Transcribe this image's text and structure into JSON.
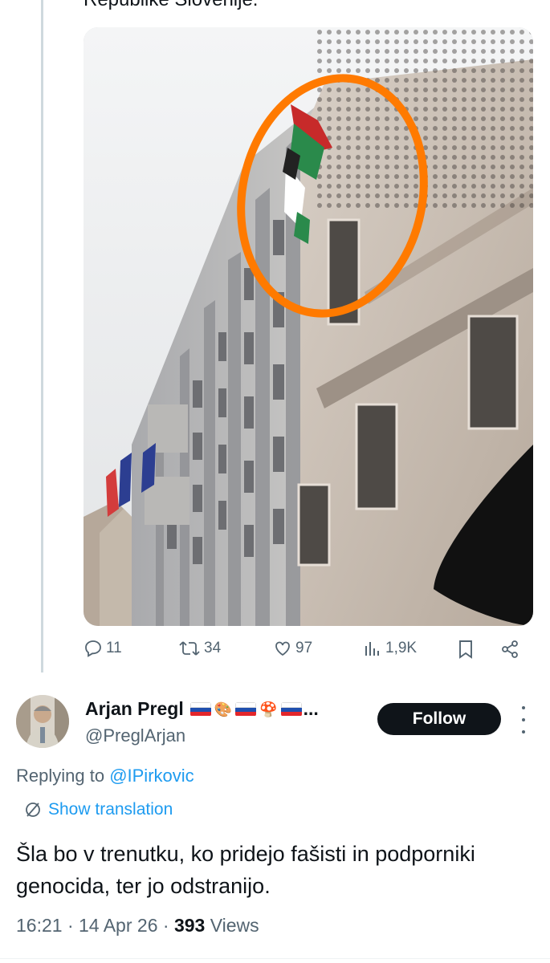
{
  "previous_tweet": {
    "cut_text": "Republike Slovenije.",
    "image_alt": "photo of government building with flags",
    "actions": {
      "replies": "11",
      "reposts": "34",
      "likes": "97",
      "views": "1,9K"
    }
  },
  "reply": {
    "author_name": "Arjan Pregl",
    "flag_emojis": [
      "🇸🇮",
      "🎨",
      "🇸🇮",
      "🍄",
      "🇸🇮"
    ],
    "name_ellipsis": "...",
    "handle": "@PreglArjan",
    "follow_label": "Follow",
    "replying_prefix": "Replying to ",
    "replying_to": "@IPirkovic",
    "show_translation": "Show translation",
    "text": "Šla bo v trenutku, ko pridejo fašisti in podporniki genocida, ter jo odstranijo.",
    "time": "16:21",
    "date": "14 Apr 26",
    "views_count": "393",
    "views_label": "Views"
  },
  "colors": {
    "accent": "#1d9bf0",
    "secondary_text": "#536471",
    "highlight_circle": "#ff7a00"
  }
}
